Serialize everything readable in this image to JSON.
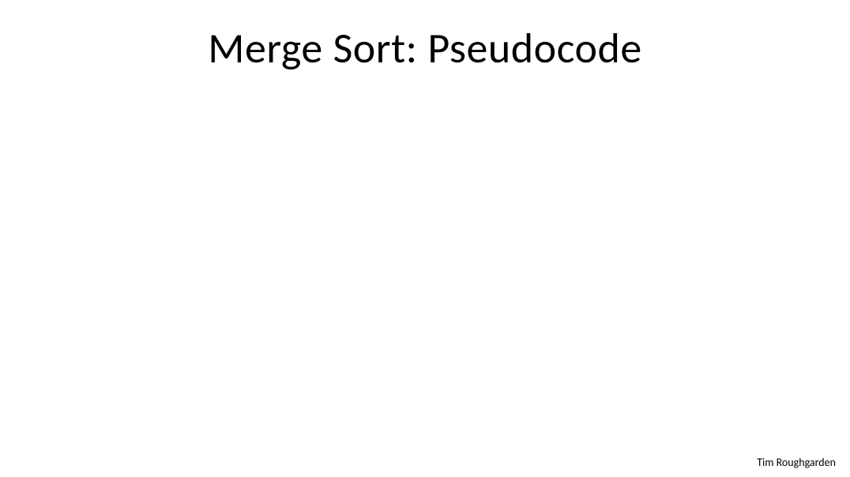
{
  "slide": {
    "title": "Merge Sort: Pseudocode",
    "author": "Tim Roughgarden"
  }
}
